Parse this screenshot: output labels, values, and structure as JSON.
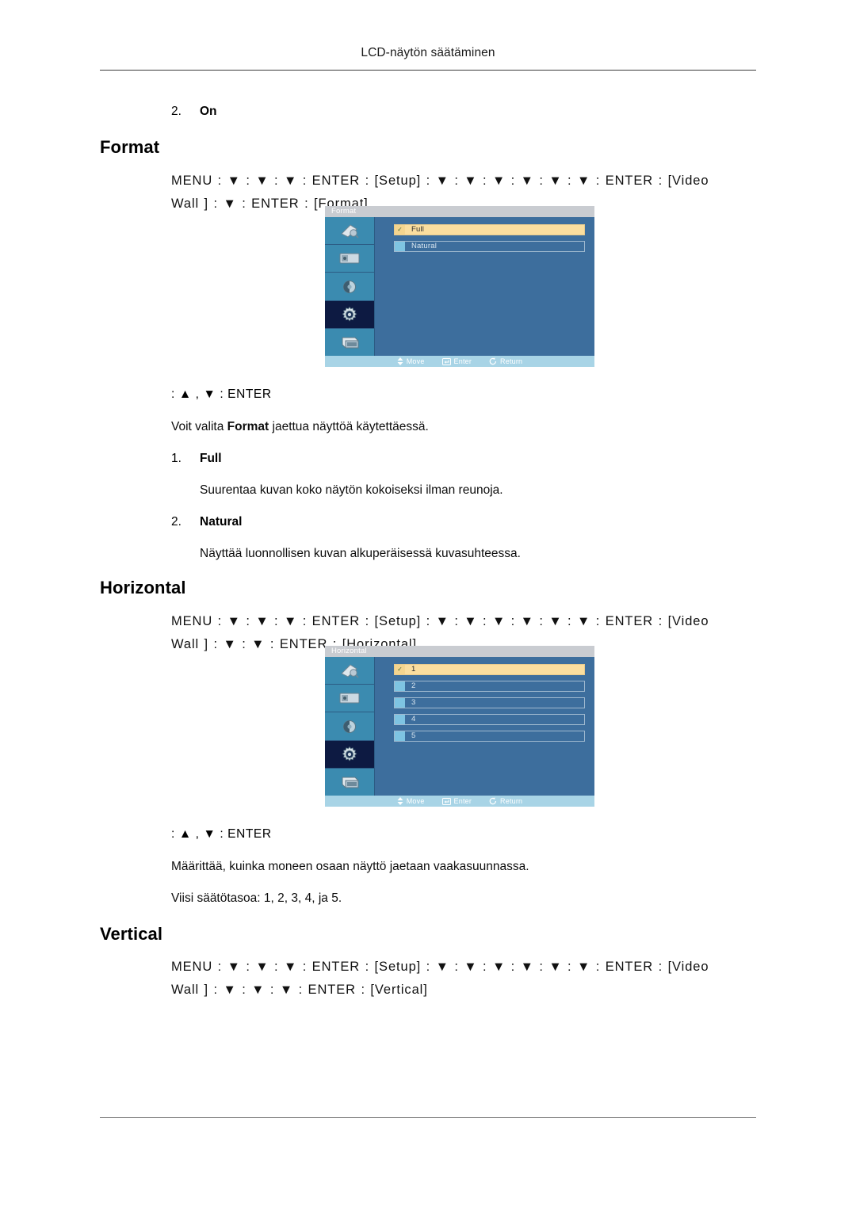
{
  "header": {
    "title": "LCD-näytön säätäminen"
  },
  "on_item": {
    "number": "2.",
    "label": "On"
  },
  "sections": [
    {
      "heading": "Format",
      "menu_path_line1": "MENU :  ▼ : ▼ : ▼ :  ENTER :  [Setup]  :  ▼ :  ▼ :  ▼ :  ▼ :  ▼ :  ▼ :  ENTER :  [Video",
      "menu_path_line2": "Wall ] :  ▼ :  ENTER  : [Format]",
      "key_line": ":  ▲ , ▼ : ENTER",
      "paragraph_pre": "Voit valita ",
      "paragraph_bold": "Format",
      "paragraph_post": " jaettua näyttöä käytettäessä.",
      "osd": {
        "title": "Format",
        "items": [
          {
            "label": "Full",
            "selected": true
          },
          {
            "label": "Natural",
            "selected": false
          }
        ],
        "footer": [
          {
            "icon": "updown-arrow-icon",
            "label": "Move"
          },
          {
            "icon": "enter-key-icon",
            "label": "Enter"
          },
          {
            "icon": "return-arrow-icon",
            "label": "Return"
          }
        ],
        "icons": [
          {
            "name": "picture-icon",
            "active": false
          },
          {
            "name": "image-size-icon",
            "active": false
          },
          {
            "name": "sound-icon",
            "active": false
          },
          {
            "name": "setup-gear-icon",
            "active": true
          },
          {
            "name": "multi-control-icon",
            "active": false
          }
        ]
      },
      "options": [
        {
          "number": "1.",
          "label": "Full",
          "description": "Suurentaa kuvan koko näytön kokoiseksi ilman reunoja."
        },
        {
          "number": "2.",
          "label": "Natural",
          "description": "Näyttää luonnollisen kuvan alkuperäisessä kuvasuhteessa."
        }
      ]
    },
    {
      "heading": "Horizontal",
      "menu_path_line1": "MENU :  ▼ : ▼ : ▼ :  ENTER :  [Setup]  :  ▼ :  ▼ :  ▼ :  ▼ :  ▼ :  ▼ :  ENTER :  [Video",
      "menu_path_line2": "Wall ] :  ▼ :  ▼ :  ENTER  : [Horizontal]",
      "key_line": ":  ▲ , ▼ : ENTER",
      "description_line1": "Määrittää, kuinka moneen osaan näyttö jaetaan vaakasuunnassa.",
      "description_line2": "Viisi säätötasoa: 1, 2, 3, 4, ja 5.",
      "osd": {
        "title": "Horizontal",
        "items": [
          {
            "label": "1",
            "selected": true
          },
          {
            "label": "2",
            "selected": false
          },
          {
            "label": "3",
            "selected": false
          },
          {
            "label": "4",
            "selected": false
          },
          {
            "label": "5",
            "selected": false
          }
        ],
        "footer": [
          {
            "icon": "updown-arrow-icon",
            "label": "Move"
          },
          {
            "icon": "enter-key-icon",
            "label": "Enter"
          },
          {
            "icon": "return-arrow-icon",
            "label": "Return"
          }
        ],
        "icons": [
          {
            "name": "picture-icon",
            "active": false
          },
          {
            "name": "image-size-icon",
            "active": false
          },
          {
            "name": "sound-icon",
            "active": false
          },
          {
            "name": "setup-gear-icon",
            "active": true
          },
          {
            "name": "multi-control-icon",
            "active": false
          }
        ]
      }
    },
    {
      "heading": "Vertical",
      "menu_path_line1": "MENU :  ▼ : ▼ : ▼ :  ENTER :  [Setup]  :  ▼ :  ▼ :  ▼ :  ▼ :  ▼ :  ▼ :  ENTER :  [Video",
      "menu_path_line2": "Wall ] :  ▼ :  ▼ :  ▼ :  ENTER  : [Vertical]"
    }
  ],
  "colors": {
    "osd_body": "#3d6e9d",
    "osd_title_bar": "#c9ccd1",
    "osd_icon_bg": "#3b8bb0",
    "osd_icon_active": "#0d1a42",
    "osd_selected_row": "#fade9f",
    "osd_footer": "#a8d4e6",
    "swatch": "#7ec4e2"
  }
}
